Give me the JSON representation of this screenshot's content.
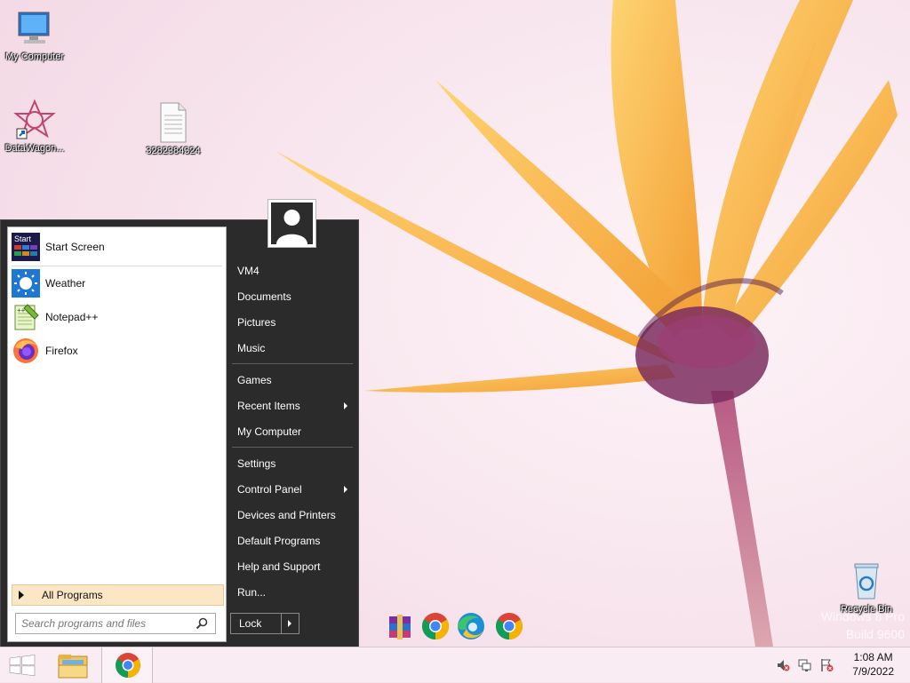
{
  "desktop": {
    "icons": [
      {
        "label": "My Computer"
      },
      {
        "label": "DataWagon..."
      },
      {
        "label": "3282384324"
      },
      {
        "label": "Recycle Bin"
      }
    ],
    "watermark": {
      "line1": "Windows 8 Pro",
      "line2": "Build 9600"
    }
  },
  "start_menu": {
    "pinned": [
      {
        "label": "Start Screen",
        "icon": "start-screen-icon"
      },
      {
        "label": "Weather",
        "icon": "weather-icon"
      },
      {
        "label": "Notepad++",
        "icon": "notepad-plus-plus-icon"
      },
      {
        "label": "Firefox",
        "icon": "firefox-icon"
      }
    ],
    "all_programs": "All Programs",
    "search_placeholder": "Search programs and files",
    "right": {
      "user": "VM4",
      "documents": "Documents",
      "pictures": "Pictures",
      "music": "Music",
      "games": "Games",
      "recent_items": "Recent Items",
      "my_computer": "My Computer",
      "settings": "Settings",
      "control_panel": "Control Panel",
      "devices_printers": "Devices and Printers",
      "default_programs": "Default Programs",
      "help_support": "Help and Support",
      "run": "Run..."
    },
    "lock": "Lock"
  },
  "dock": [
    "winrar-icon",
    "chrome-icon",
    "edge-icon",
    "chrome-icon"
  ],
  "taskbar": {
    "buttons": [
      "start-button",
      "file-explorer-icon",
      "chrome-icon"
    ],
    "tray": [
      "volume-muted-icon",
      "network-icon",
      "action-center-icon"
    ],
    "time": "1:08 AM",
    "date": "7/9/2022"
  },
  "colors": {
    "menu_bg": "#2b2b2b",
    "highlight": "#fbe6c5",
    "petal": "#f6a838",
    "flower_center": "#7b2d5e"
  }
}
